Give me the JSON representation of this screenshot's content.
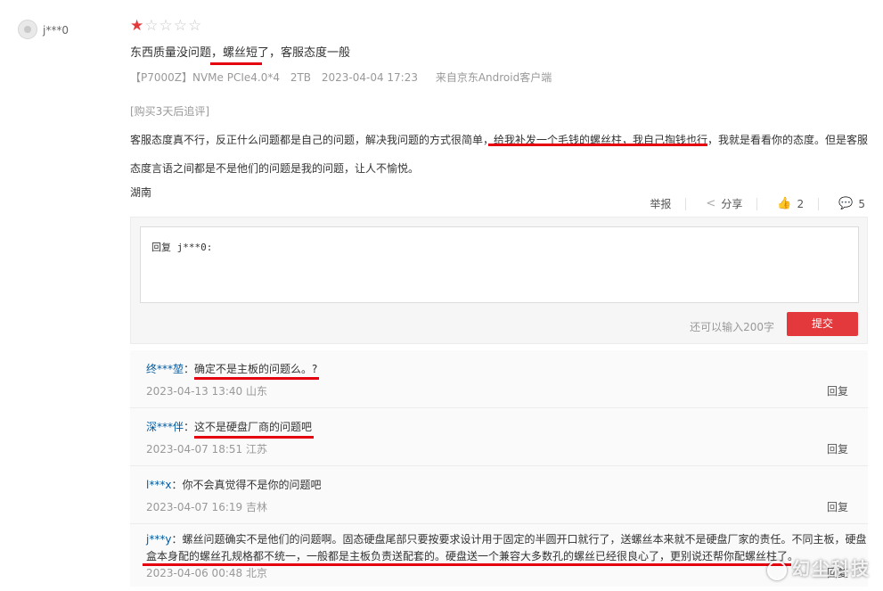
{
  "review": {
    "username": "j***0",
    "rating": 1,
    "max_rating": 5,
    "text_before": "东西质量没问题，",
    "text_highlight": "螺丝短了",
    "text_after": "，客服态度一般",
    "product_variant": "【P7000Z】NVMe PCIe4.0*4",
    "capacity": "2TB",
    "datetime": "2023-04-04 17:23",
    "source": "来自京东Android客户端",
    "followup_tag": "[购买3天后追评]",
    "followup_before": "客服态度真不行，反正什么问题都是自己的问题，解决我问题的方式很简单，",
    "followup_highlight": "给我补发一个毛钱的螺丝柱，我自己掏钱也行",
    "followup_after": "，我就是看看你的态度。但是客服态度言语之间都是不是他们的问题是我的问题，让人不愉悦。",
    "province": "湖南"
  },
  "actions": {
    "report": "举报",
    "share": "分享",
    "likes": "2",
    "comments": "5"
  },
  "reply_form": {
    "text": "回复 j***0:",
    "remaining": "还可以输入200字",
    "submit": "提交"
  },
  "replies": [
    {
      "nick": "终***堃",
      "text": "确定不是主板的问题么。?",
      "datetime": "2023-04-13 13:40",
      "location": "山东",
      "reply_label": "回复"
    },
    {
      "nick": "深***伴",
      "text": "这不是硬盘厂商的问题吧",
      "datetime": "2023-04-07 18:51",
      "location": "江苏",
      "reply_label": "回复"
    },
    {
      "nick": "l***x",
      "text": "你不会真觉得不是你的问题吧",
      "datetime": "2023-04-07 16:19",
      "location": "吉林",
      "reply_label": "回复"
    },
    {
      "nick": "j***y",
      "text": "螺丝问题确实不是他们的问题啊。固态硬盘尾部只要按要求设计用于固定的半圆开口就行了，送螺丝本来就不是硬盘厂家的责任。不同主板，硬盘盒本身配的螺丝孔规格都不统一，一般都是主板负责送配套的。硬盘送一个兼容大多数孔的螺丝已经很良心了，更别说还帮你配螺丝柱了。",
      "datetime": "2023-04-06 00:48",
      "location": "北京",
      "reply_label": "回复"
    }
  ],
  "watermark": "幻尘科技",
  "colors": {
    "accent": "#e4393c",
    "nick": "#005aa0",
    "annotation": "#e4000f"
  }
}
